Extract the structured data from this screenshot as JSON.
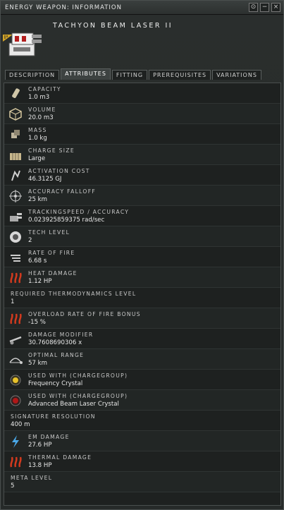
{
  "window": {
    "title": "ENERGY WEAPON: INFORMATION",
    "buttons": {
      "info": "⊙",
      "minimize": "−",
      "close": "×"
    }
  },
  "item": {
    "name": "TACHYON BEAM LASER II"
  },
  "tabs": [
    {
      "label": "DESCRIPTION",
      "active": false
    },
    {
      "label": "ATTRIBUTES",
      "active": true
    },
    {
      "label": "FITTING",
      "active": false
    },
    {
      "label": "PREREQUISITES",
      "active": false
    },
    {
      "label": "VARIATIONS",
      "active": false
    }
  ],
  "attributes": [
    {
      "label": "CAPACITY",
      "value": "1.0 m3",
      "icon": "capacity-icon"
    },
    {
      "label": "VOLUME",
      "value": "20.0 m3",
      "icon": "volume-icon"
    },
    {
      "label": "MASS",
      "value": "1.0 kg",
      "icon": "mass-icon"
    },
    {
      "label": "CHARGE SIZE",
      "value": "Large",
      "icon": "charge-size-icon"
    },
    {
      "label": "ACTIVATION COST",
      "value": "46.3125 GJ",
      "icon": "activation-cost-icon"
    },
    {
      "label": "ACCURACY FALLOFF",
      "value": "25 km",
      "icon": "falloff-icon"
    },
    {
      "label": "TRACKINGSPEED / ACCURACY",
      "value": "0.023925859375 rad/sec",
      "icon": "tracking-icon"
    },
    {
      "label": "TECH LEVEL",
      "value": "2",
      "icon": "tech-level-icon"
    },
    {
      "label": "RATE OF FIRE",
      "value": "6.68 s",
      "icon": "rate-of-fire-icon"
    },
    {
      "label": "HEAT DAMAGE",
      "value": "1.12 HP",
      "icon": "heat-damage-icon"
    },
    {
      "label": "REQUIRED THERMODYNAMICS LEVEL",
      "value": "1",
      "icon": ""
    },
    {
      "label": "OVERLOAD RATE OF FIRE BONUS",
      "value": "-15 %",
      "icon": "overload-icon"
    },
    {
      "label": "DAMAGE MODIFIER",
      "value": "30.7608690306 x",
      "icon": "damage-modifier-icon"
    },
    {
      "label": "OPTIMAL RANGE",
      "value": "57 km",
      "icon": "optimal-range-icon"
    },
    {
      "label": "USED WITH (CHARGEGROUP)",
      "value": "Frequency Crystal",
      "icon": "frequency-crystal-icon"
    },
    {
      "label": "USED WITH (CHARGEGROUP)",
      "value": "Advanced Beam Laser Crystal",
      "icon": "advanced-crystal-icon"
    },
    {
      "label": "SIGNATURE RESOLUTION",
      "value": "400 m",
      "icon": ""
    },
    {
      "label": "EM DAMAGE",
      "value": "27.6 HP",
      "icon": "em-damage-icon"
    },
    {
      "label": "THERMAL DAMAGE",
      "value": "13.8 HP",
      "icon": "thermal-damage-icon"
    },
    {
      "label": "META LEVEL",
      "value": "5",
      "icon": ""
    }
  ]
}
